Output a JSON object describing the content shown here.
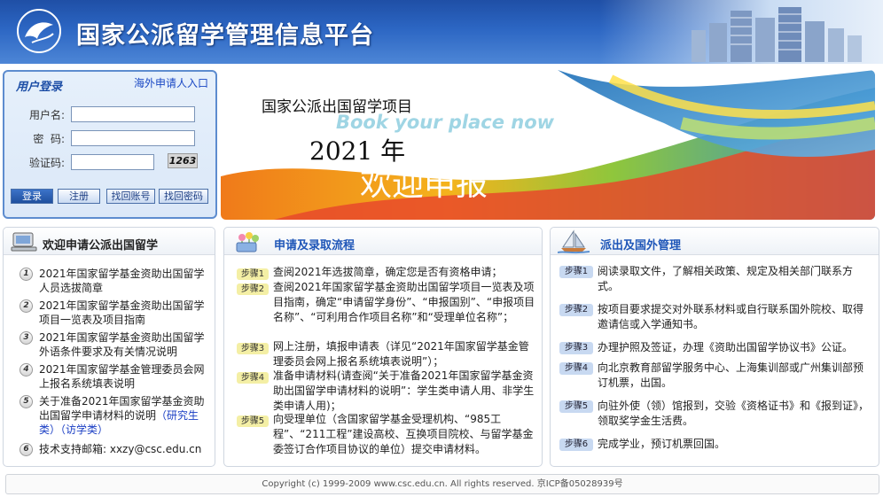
{
  "header": {
    "title": "国家公派留学管理信息平台",
    "logo_icon": "csc-dove-logo-icon"
  },
  "login": {
    "title": "用户登录",
    "overseas_link": "海外申请人入口",
    "username_label": "用户名:",
    "password_label": "密  码:",
    "captcha_label": "验证码:",
    "captcha_code": "1263",
    "buttons": {
      "login": "登录",
      "register": "注册",
      "recover_account": "找回账号",
      "recover_password": "找回密码"
    }
  },
  "banner": {
    "heading": "国家公派出国留学项目",
    "tagline": "Book your place now",
    "year": "2021 年",
    "welcome": "欢迎申报"
  },
  "welcome_panel": {
    "title": "欢迎申请公派出国留学",
    "items": [
      {
        "num": "1",
        "text": "2021年国家留学基金资助出国留学人员选拔简章"
      },
      {
        "num": "2",
        "text": "2021年国家留学基金资助出国留学项目一览表及项目指南"
      },
      {
        "num": "3",
        "text": "2021年国家留学基金资助出国留学外语条件要求及有关情况说明"
      },
      {
        "num": "4",
        "text": "2021年国家留学基金管理委员会网上报名系统填表说明"
      },
      {
        "num": "5",
        "text": "关于准备2021年国家留学基金资助出国留学申请材料的说明",
        "link": "（研究生类）（访学类）"
      },
      {
        "num": "6",
        "text": "技术支持邮箱: xxzy@csc.edu.cn"
      }
    ]
  },
  "flow_panel": {
    "title": "申请及录取流程",
    "steps": [
      {
        "badge": "步骤1",
        "text": "查阅2021年选拔简章，确定您是否有资格申请；"
      },
      {
        "badge": "步骤2",
        "text": "查阅2021年国家留学基金资助出国留学项目一览表及项目指南，确定“申请留学身份”、“申报国别”、“申报项目名称”、“可利用合作项目名称”和“受理单位名称”；"
      },
      {
        "badge": "步骤3",
        "text": "网上注册，填报申请表（详见“2021年国家留学基金管理委员会网上报名系统填表说明”）；"
      },
      {
        "badge": "步骤4",
        "text": "准备申请材料(请查阅“关于准备2021年国家留学基金资助出国留学申请材料的说明”：学生类申请人用、非学生类申请人用)；"
      },
      {
        "badge": "步骤5",
        "text": "向受理单位（含国家留学基金受理机构、“985工程”、“211工程”建设高校、互换项目院校、与留学基金委签订合作项目协议的单位）提交申请材料。"
      }
    ]
  },
  "manage_panel": {
    "title": "派出及国外管理",
    "steps": [
      {
        "badge": "步骤1",
        "text": "阅读录取文件，了解相关政策、规定及相关部门联系方式。"
      },
      {
        "badge": "步骤2",
        "text": "按项目要求提交对外联系材料或自行联系国外院校、取得邀请信或入学通知书。"
      },
      {
        "badge": "步骤3",
        "text": "办理护照及签证，办理《资助出国留学协议书》公证。"
      },
      {
        "badge": "步骤4",
        "text": "向北京教育部留学服务中心、上海集训部或广州集训部预订机票，出国。"
      },
      {
        "badge": "步骤5",
        "text": "向驻外使（领）馆报到，交验《资格证书》和《报到证》，领取奖学金生活费。"
      },
      {
        "badge": "步骤6",
        "text": "完成学业，预订机票回国。"
      }
    ]
  },
  "footer": {
    "text": "Copyright (c) 1999-2009 www.csc.edu.cn.  All rights reserved.   京ICP备05028939号"
  }
}
